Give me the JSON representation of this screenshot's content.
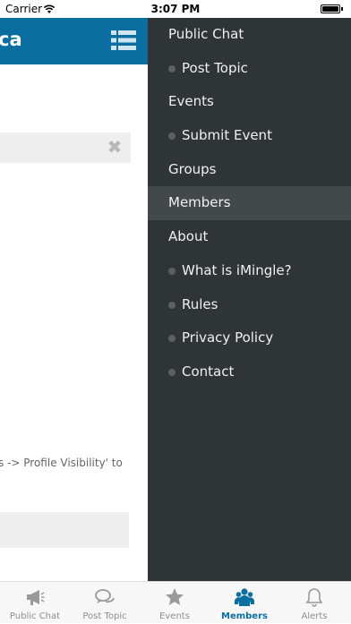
{
  "status_bar": {
    "carrier": "Carrier",
    "time": "3:07 PM"
  },
  "header": {
    "title": "ca"
  },
  "main": {
    "hint_text": "s -> Profile Visibility' to",
    "clear_icon": "close-icon"
  },
  "drawer": {
    "items": [
      {
        "label": "Public Chat",
        "sub": false
      },
      {
        "label": "Post Topic",
        "sub": true
      },
      {
        "label": "Events",
        "sub": false
      },
      {
        "label": "Submit Event",
        "sub": true
      },
      {
        "label": "Groups",
        "sub": false
      },
      {
        "label": "Members",
        "sub": false,
        "active": true
      },
      {
        "label": "About",
        "sub": false
      },
      {
        "label": "What is iMingle?",
        "sub": true
      },
      {
        "label": "Rules",
        "sub": true
      },
      {
        "label": "Privacy Policy",
        "sub": true
      },
      {
        "label": "Contact",
        "sub": true
      }
    ]
  },
  "tabs": [
    {
      "label": "Public Chat",
      "icon": "megaphone-icon"
    },
    {
      "label": "Post Topic",
      "icon": "chat-bubbles-icon"
    },
    {
      "label": "Events",
      "icon": "star-icon"
    },
    {
      "label": "Members",
      "icon": "members-icon",
      "active": true
    },
    {
      "label": "Alerts",
      "icon": "bell-icon"
    }
  ],
  "colors": {
    "accent": "#0a6fa0",
    "drawer_bg": "#2f3436",
    "drawer_active": "#43494b"
  }
}
